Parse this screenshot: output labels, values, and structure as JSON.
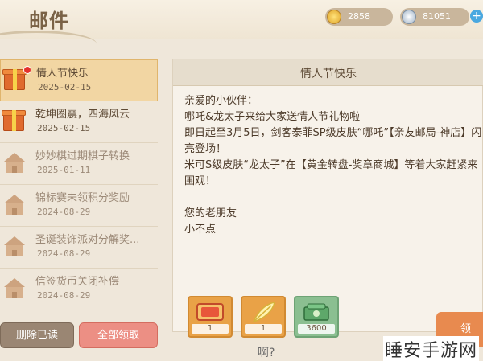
{
  "header": {
    "title": "邮件",
    "gold": "2858",
    "diamond": "81051",
    "plus": "+"
  },
  "mails": [
    {
      "title": "情人节快乐",
      "date": "2025-02-15",
      "icon": "gift-icon",
      "unread": true
    },
    {
      "title": "乾坤圈震，四海风云",
      "date": "2025-02-15",
      "icon": "gift-icon",
      "unread": false
    },
    {
      "title": "妙妙棋过期棋子转换",
      "date": "2025-01-11",
      "icon": "house-icon",
      "unread": false
    },
    {
      "title": "锦标赛未领积分奖励",
      "date": "2024-08-29",
      "icon": "house-icon",
      "unread": false
    },
    {
      "title": "圣诞装饰派对分解奖...",
      "date": "2024-08-29",
      "icon": "house-icon",
      "unread": false
    },
    {
      "title": "信签货币关闭补偿",
      "date": "2024-08-29",
      "icon": "house-icon",
      "unread": false
    }
  ],
  "detail": {
    "title": "情人节快乐",
    "body": "亲爱的小伙伴：\n哪吒&龙太子来给大家送情人节礼物啦\n即日起至3月5日，剑客泰菲SP级皮肤“哪吒”【亲友邮局-神店】闪亮登场！\n米可S级皮肤“龙太子”在【黄金转盘-奖章商城】等着大家赶紧来围观！\n\n您的老朋友\n小不点",
    "rewards": [
      {
        "name": "ticket-icon",
        "count": "1"
      },
      {
        "name": "feather-icon",
        "count": "1"
      },
      {
        "name": "cash-icon",
        "count": "3600"
      }
    ],
    "claim_label": "领"
  },
  "buttons": {
    "delete_read": "删除已读",
    "claim_all": "全部领取"
  },
  "bottom_hint": "啊?",
  "watermark": "睡安手游网",
  "colors": {
    "selected_bg": "#f2d6a3",
    "claim_all": "#ec8f84",
    "delete_read": "#9a8673",
    "reward_orange": "#e9a247",
    "reward_green": "#8bbf91"
  }
}
